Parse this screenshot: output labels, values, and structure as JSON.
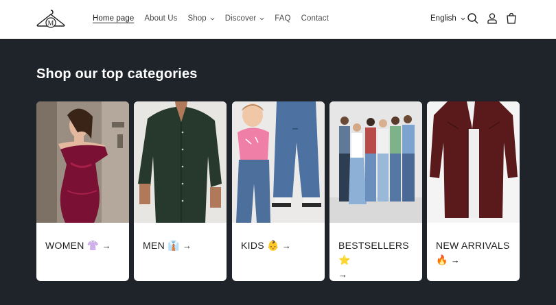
{
  "header": {
    "logo_letter": "M",
    "nav": [
      {
        "label": "Home page",
        "active": true,
        "dropdown": false
      },
      {
        "label": "About Us",
        "active": false,
        "dropdown": false
      },
      {
        "label": "Shop",
        "active": false,
        "dropdown": true
      },
      {
        "label": "Discover",
        "active": false,
        "dropdown": true
      },
      {
        "label": "FAQ",
        "active": false,
        "dropdown": false
      },
      {
        "label": "Contact",
        "active": false,
        "dropdown": false
      }
    ],
    "language": "English",
    "icons": [
      "search-icon",
      "account-icon",
      "cart-icon"
    ]
  },
  "section": {
    "title": "Shop our top categories",
    "categories": [
      {
        "label": "WOMEN 👚",
        "arrow": "→"
      },
      {
        "label": "MEN 👔",
        "arrow": "→"
      },
      {
        "label": "KIDS 👶",
        "arrow": "→"
      },
      {
        "label": "BESTSELLERS ⭐",
        "arrow": "→"
      },
      {
        "label": "NEW ARRIVALS 🔥",
        "arrow": "→"
      }
    ]
  },
  "colors": {
    "background": "#1f232a",
    "header": "#ffffff",
    "card": "#ffffff"
  }
}
